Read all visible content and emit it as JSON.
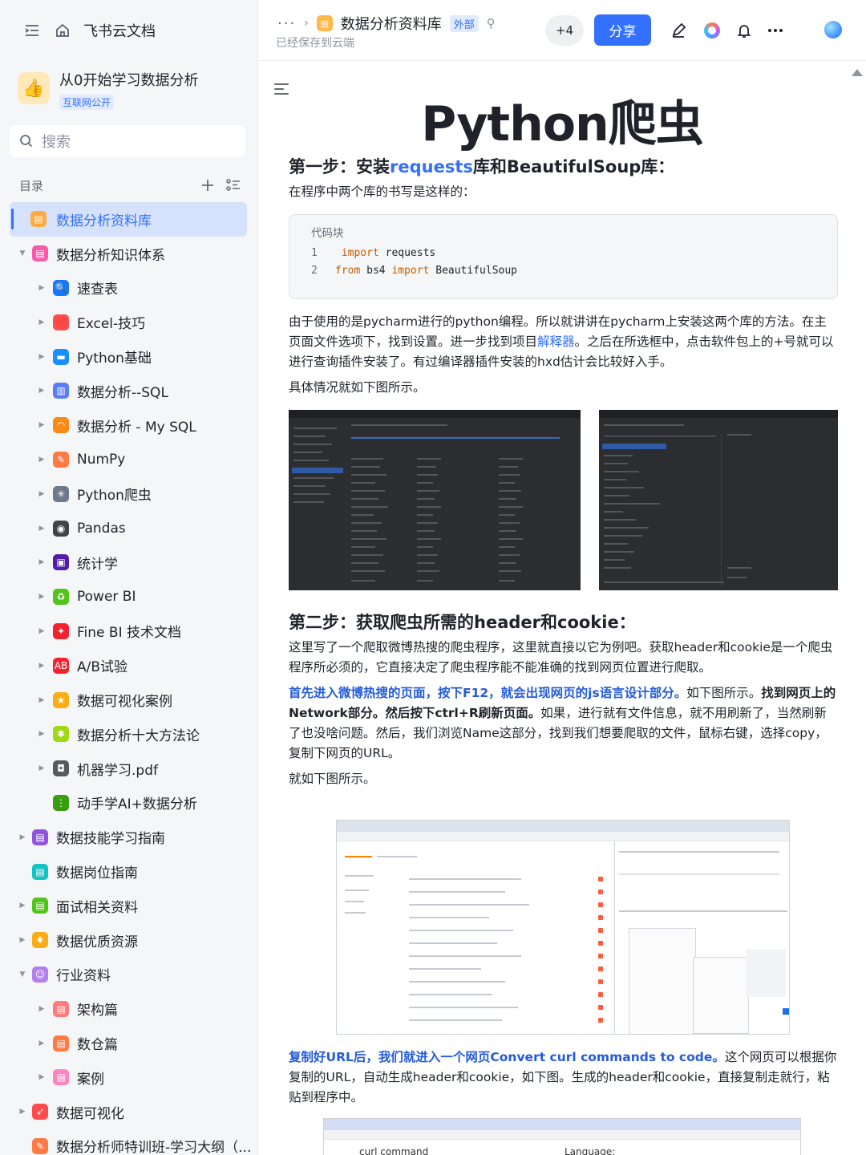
{
  "sidebar": {
    "app_title": "飞书云文档",
    "space_name": "从0开始学习数据分析",
    "space_tag": "互联网公开",
    "search_placeholder": "搜索",
    "toc_label": "目录",
    "items": [
      {
        "label": "数据分析资料库",
        "icon": "doc-icon",
        "color": "#ffa940",
        "active": true,
        "level": 0,
        "caret": ""
      },
      {
        "label": "数据分析知识体系",
        "icon": "doc-icon",
        "color": "#f759ab",
        "level": 0,
        "caret": "▼"
      },
      {
        "label": "速查表",
        "icon": "magnifier-icon",
        "color": "#1677ff",
        "level": 1,
        "caret": "▶"
      },
      {
        "label": "Excel-技巧",
        "icon": "hundred-icon",
        "color": "#ff4d4f",
        "level": 1,
        "caret": "▶"
      },
      {
        "label": "Python基础",
        "icon": "computer-icon",
        "color": "#1890ff",
        "level": 1,
        "caret": "▶"
      },
      {
        "label": "数据分析--SQL",
        "icon": "bar-chart-icon",
        "color": "#597ef7",
        "level": 1,
        "caret": "▶"
      },
      {
        "label": "数据分析 - My SQL",
        "icon": "rainbow-icon",
        "color": "#fa8c16",
        "level": 1,
        "caret": "▶"
      },
      {
        "label": "NumPy",
        "icon": "memo-icon",
        "color": "#ff7a45",
        "level": 1,
        "caret": "▶"
      },
      {
        "label": "Python爬虫",
        "icon": "spider-icon",
        "color": "#6e7a8a",
        "level": 1,
        "caret": "▶"
      },
      {
        "label": "Pandas",
        "icon": "panda-icon",
        "color": "#434343",
        "level": 1,
        "caret": "▶"
      },
      {
        "label": "统计学",
        "icon": "floppy-icon",
        "color": "#531dab",
        "level": 1,
        "caret": "▶"
      },
      {
        "label": "Power BI",
        "icon": "recycle-icon",
        "color": "#52c41a",
        "level": 1,
        "caret": "▶"
      },
      {
        "label": "Fine BI 技术文档",
        "icon": "pin-icon",
        "color": "#f5222d",
        "level": 1,
        "caret": "▶"
      },
      {
        "label": "A/B试验",
        "icon": "ab-icon",
        "color": "#f5222d",
        "level": 1,
        "caret": "▶"
      },
      {
        "label": "数据可视化案例",
        "icon": "medal-icon",
        "color": "#faad14",
        "level": 1,
        "caret": "▶"
      },
      {
        "label": "数据分析十大方法论",
        "icon": "sparkle-icon",
        "color": "#a0d911",
        "level": 1,
        "caret": "▶"
      },
      {
        "label": "机器学习.pdf",
        "icon": "robot-icon",
        "color": "#595959",
        "level": 1,
        "caret": "▶"
      },
      {
        "label": "动手学AI+数据分析",
        "icon": "traffic-light-icon",
        "color": "#389e0d",
        "level": 1,
        "caret": ""
      },
      {
        "label": "数据技能学习指南",
        "icon": "doc-icon",
        "color": "#9254de",
        "level": 0,
        "caret": "▶"
      },
      {
        "label": "数据岗位指南",
        "icon": "doc-icon",
        "color": "#13c2c2",
        "level": 0,
        "caret": ""
      },
      {
        "label": "面试相关资料",
        "icon": "doc-icon",
        "color": "#52c41a",
        "level": 0,
        "caret": "▶"
      },
      {
        "label": "数据优质资源",
        "icon": "thumb-icon",
        "color": "#faad14",
        "level": 0,
        "caret": "▶"
      },
      {
        "label": "行业资料",
        "icon": "ghost-icon",
        "color": "#b37feb",
        "level": 0,
        "caret": "▼"
      },
      {
        "label": "架构篇",
        "icon": "doc-icon",
        "color": "#ff7a7a",
        "level": 1,
        "caret": "▶"
      },
      {
        "label": "数仓篇",
        "icon": "doc-icon",
        "color": "#ff7a45",
        "level": 1,
        "caret": "▶"
      },
      {
        "label": "案例",
        "icon": "doc-icon",
        "color": "#ff85c0",
        "level": 1,
        "caret": "▶"
      },
      {
        "label": "数据可视化",
        "icon": "rocket-icon",
        "color": "#ff4d4f",
        "level": 0,
        "caret": "▶"
      },
      {
        "label": "数据分析师特训班-学习大纲（...",
        "icon": "memo-icon",
        "color": "#ff7a45",
        "level": 0,
        "caret": ""
      }
    ]
  },
  "topbar": {
    "breadcrumb_title": "数据分析资料库",
    "badge": "外部",
    "saved_status": "已经保存到云端",
    "collaborators": "+4",
    "share_label": "分享"
  },
  "doc": {
    "title": "Python爬虫",
    "step1_prefix": "第一步：安装",
    "step1_link": "requests",
    "step1_suffix": "库和BeautifulSoup库：",
    "step1_intro": "在程序中两个库的书写是这样的：",
    "code_label": "代码块",
    "code_lines": [
      {
        "no": "1",
        "kw": "import",
        "rest": " requests",
        "pre": " "
      },
      {
        "no": "2",
        "kw": "from",
        "rest": " bs4 ",
        "kw2": "import",
        "rest2": " BeautifulSoup",
        "pre": ""
      }
    ],
    "para1_a": "由于使用的是pycharm进行的python编程。所以就讲讲在pycharm上安装这两个库的方法。在主页面文件选项下，找到设置。进一步找到项目",
    "para1_link": "解释器",
    "para1_b": "。之后在所选框中，点击软件包上的+号就可以进行查询插件安装了。有过编译器插件安装的hxd估计会比较好入手。",
    "para2": "具体情况就如下图所示。",
    "step2": "第二步：获取爬虫所需的header和cookie：",
    "para3": "这里写了一个爬取微博热搜的爬虫程序，这里就直接以它为例吧。获取header和cookie是一个爬虫程序所必须的，它直接决定了爬虫程序能不能准确的找到网页位置进行爬取。",
    "para4_blue": "首先进入微博热搜的页面，按下F12，就会出现网页的js语言设计部分。",
    "para4_mid": "如下图所示。",
    "para4_bold": "找到网页上的Network部分。然后按下ctrl+R刷新页面。",
    "para4_rest": "如果，进行就有文件信息，就不用刷新了，当然刷新了也没啥问题。然后，我们浏览Name这部分，找到我们想要爬取的文件，鼠标右键，选择copy，复制下网页的URL。",
    "para5": "就如下图所示。",
    "para6_blue": "复制好URL后，我们就进入一个网页Convert curl commands to code。",
    "para6_rest": "这个网页可以根据你复制的URL，自动生成header和cookie，如下图。生成的header和cookie，直接复制走就行，粘贴到程序中。",
    "shot3_bottom_left": "curl command",
    "shot3_bottom_right": "Language:"
  }
}
